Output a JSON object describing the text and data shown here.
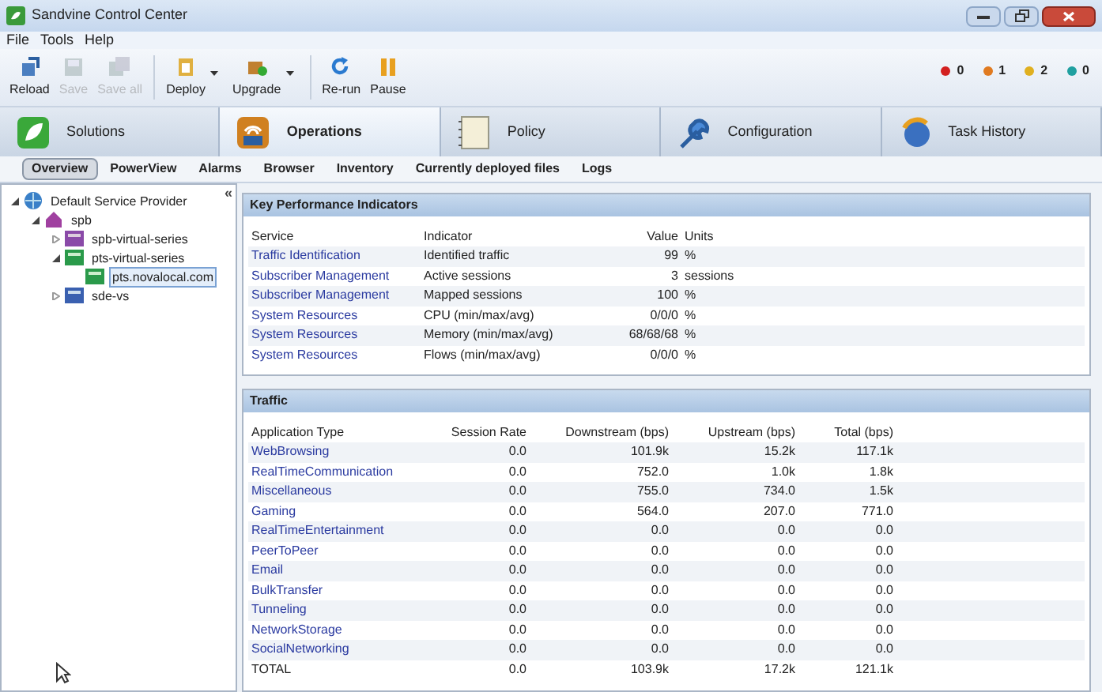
{
  "window": {
    "title": "Sandvine Control Center"
  },
  "menu": [
    "File",
    "Tools",
    "Help"
  ],
  "toolbar": [
    {
      "label": "Reload",
      "kind": "reload",
      "disabled": false,
      "dropdown": false
    },
    {
      "label": "Save",
      "kind": "save",
      "disabled": true,
      "dropdown": false
    },
    {
      "label": "Save all",
      "kind": "saveall",
      "disabled": true,
      "dropdown": false
    },
    {
      "label": "Deploy",
      "kind": "deploy",
      "disabled": false,
      "dropdown": true
    },
    {
      "label": "Upgrade",
      "kind": "upgrade",
      "disabled": false,
      "dropdown": true
    },
    {
      "label": "Re-run",
      "kind": "rerun",
      "disabled": false,
      "dropdown": false
    },
    {
      "label": "Pause",
      "kind": "pause",
      "disabled": false,
      "dropdown": false
    }
  ],
  "alarm_counts": [
    {
      "count": "0",
      "color": "#d32020"
    },
    {
      "count": "1",
      "color": "#e07a20"
    },
    {
      "count": "2",
      "color": "#e0b020"
    },
    {
      "count": "0",
      "color": "#20a0a0"
    }
  ],
  "main_tabs": [
    {
      "label": "Solutions",
      "kind": "solutions",
      "selected": false
    },
    {
      "label": "Operations",
      "kind": "operations",
      "selected": true
    },
    {
      "label": "Policy",
      "kind": "policy",
      "selected": false
    },
    {
      "label": "Configuration",
      "kind": "configuration",
      "selected": false
    },
    {
      "label": "Task History",
      "kind": "history",
      "selected": false
    }
  ],
  "sub_tabs": [
    {
      "label": "Overview",
      "selected": true
    },
    {
      "label": "PowerView",
      "selected": false
    },
    {
      "label": "Alarms",
      "selected": false
    },
    {
      "label": "Browser",
      "selected": false
    },
    {
      "label": "Inventory",
      "selected": false
    },
    {
      "label": "Currently deployed files",
      "selected": false
    },
    {
      "label": "Logs",
      "selected": false
    }
  ],
  "sidebar": {
    "collapse": "«",
    "tree": [
      {
        "label": "Default Service Provider",
        "kind": "provider",
        "expanded": true,
        "selected": false,
        "children": [
          {
            "label": "spb",
            "kind": "folder",
            "expanded": true,
            "selected": false,
            "children": [
              {
                "label": "spb-virtual-series",
                "kind": "spb",
                "expanded": false,
                "selected": false
              },
              {
                "label": "pts-virtual-series",
                "kind": "pts",
                "expanded": true,
                "selected": false,
                "children": [
                  {
                    "label": "pts.novalocal.com",
                    "kind": "pts",
                    "selected": true
                  }
                ]
              },
              {
                "label": "sde-vs",
                "kind": "sde",
                "expanded": false,
                "selected": false
              }
            ]
          }
        ]
      }
    ]
  },
  "kpi": {
    "title": "Key Performance Indicators",
    "columns": [
      "Service",
      "Indicator",
      "Value",
      "Units"
    ],
    "rows": [
      [
        "Traffic Identification",
        "Identified traffic",
        "99",
        "%"
      ],
      [
        "Subscriber Management",
        "Active sessions",
        "3",
        "sessions"
      ],
      [
        "Subscriber Management",
        "Mapped sessions",
        "100",
        "%"
      ],
      [
        "System Resources",
        "CPU (min/max/avg)",
        "0/0/0",
        "%"
      ],
      [
        "System Resources",
        "Memory (min/max/avg)",
        "68/68/68",
        "%"
      ],
      [
        "System Resources",
        "Flows (min/max/avg)",
        "0/0/0",
        "%"
      ]
    ]
  },
  "traffic": {
    "title": "Traffic",
    "columns": [
      "Application Type",
      "Session Rate",
      "Downstream (bps)",
      "Upstream (bps)",
      "Total (bps)"
    ],
    "rows": [
      {
        "kind": "link",
        "cells": [
          "WebBrowsing",
          "0.0",
          "101.9k",
          "15.2k",
          "117.1k"
        ]
      },
      {
        "kind": "link",
        "cells": [
          "RealTimeCommunication",
          "0.0",
          "752.0",
          "1.0k",
          "1.8k"
        ]
      },
      {
        "kind": "link",
        "cells": [
          "Miscellaneous",
          "0.0",
          "755.0",
          "734.0",
          "1.5k"
        ]
      },
      {
        "kind": "link",
        "cells": [
          "Gaming",
          "0.0",
          "564.0",
          "207.0",
          "771.0"
        ]
      },
      {
        "kind": "link",
        "cells": [
          "RealTimeEntertainment",
          "0.0",
          "0.0",
          "0.0",
          "0.0"
        ]
      },
      {
        "kind": "link",
        "cells": [
          "PeerToPeer",
          "0.0",
          "0.0",
          "0.0",
          "0.0"
        ]
      },
      {
        "kind": "link",
        "cells": [
          "Email",
          "0.0",
          "0.0",
          "0.0",
          "0.0"
        ]
      },
      {
        "kind": "link",
        "cells": [
          "BulkTransfer",
          "0.0",
          "0.0",
          "0.0",
          "0.0"
        ]
      },
      {
        "kind": "link",
        "cells": [
          "Tunneling",
          "0.0",
          "0.0",
          "0.0",
          "0.0"
        ]
      },
      {
        "kind": "link",
        "cells": [
          "NetworkStorage",
          "0.0",
          "0.0",
          "0.0",
          "0.0"
        ]
      },
      {
        "kind": "link",
        "cells": [
          "SocialNetworking",
          "0.0",
          "0.0",
          "0.0",
          "0.0"
        ]
      },
      {
        "kind": "total",
        "cells": [
          "TOTAL",
          "0.0",
          "103.9k",
          "17.2k",
          "121.1k"
        ]
      }
    ]
  }
}
